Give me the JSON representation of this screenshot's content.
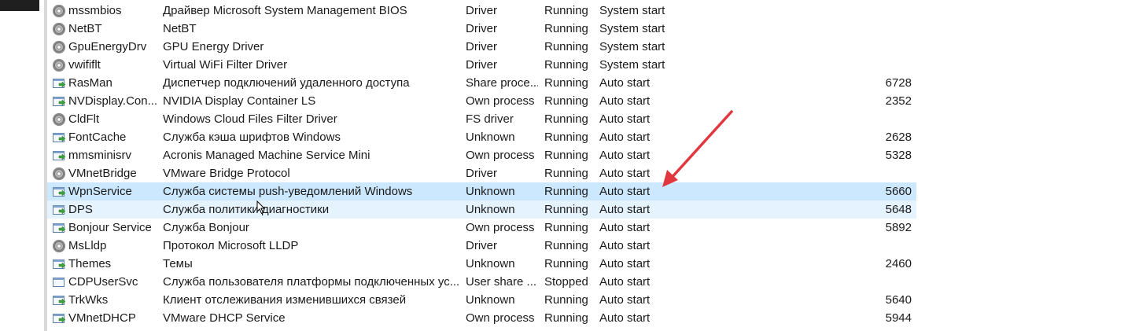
{
  "services": [
    {
      "name": "mssmbios",
      "description": "Драйвер Microsoft System Management BIOS",
      "type": "Driver",
      "status": "Running",
      "start": "System start",
      "pid": "",
      "icon": "gear-icon"
    },
    {
      "name": "NetBT",
      "description": "NetBT",
      "type": "Driver",
      "status": "Running",
      "start": "System start",
      "pid": "",
      "icon": "gear-icon"
    },
    {
      "name": "GpuEnergyDrv",
      "description": "GPU Energy Driver",
      "type": "Driver",
      "status": "Running",
      "start": "System start",
      "pid": "",
      "icon": "gear-icon"
    },
    {
      "name": "vwififlt",
      "description": "Virtual WiFi Filter Driver",
      "type": "Driver",
      "status": "Running",
      "start": "System start",
      "pid": "",
      "icon": "gear-icon"
    },
    {
      "name": "RasMan",
      "description": "Диспетчер подключений удаленного доступа",
      "type": "Share proce...",
      "status": "Running",
      "start": "Auto start",
      "pid": "6728",
      "icon": "service-running-icon"
    },
    {
      "name": "NVDisplay.Con...",
      "description": "NVIDIA Display Container LS",
      "type": "Own process",
      "status": "Running",
      "start": "Auto start",
      "pid": "2352",
      "icon": "service-running-icon"
    },
    {
      "name": "CldFlt",
      "description": "Windows Cloud Files Filter Driver",
      "type": "FS driver",
      "status": "Running",
      "start": "Auto start",
      "pid": "",
      "icon": "gear-icon"
    },
    {
      "name": "FontCache",
      "description": "Служба кэша шрифтов Windows",
      "type": "Unknown",
      "status": "Running",
      "start": "Auto start",
      "pid": "2628",
      "icon": "service-running-icon"
    },
    {
      "name": "mmsminisrv",
      "description": "Acronis Managed Machine Service Mini",
      "type": "Own process",
      "status": "Running",
      "start": "Auto start",
      "pid": "5328",
      "icon": "service-running-icon"
    },
    {
      "name": "VMnetBridge",
      "description": "VMware Bridge Protocol",
      "type": "Driver",
      "status": "Running",
      "start": "Auto start",
      "pid": "",
      "icon": "gear-icon"
    },
    {
      "name": "WpnService",
      "description": "Служба системы push-уведомлений Windows",
      "type": "Unknown",
      "status": "Running",
      "start": "Auto start",
      "pid": "5660",
      "icon": "service-running-icon"
    },
    {
      "name": "DPS",
      "description": "Служба политики диагностики",
      "type": "Unknown",
      "status": "Running",
      "start": "Auto start",
      "pid": "5648",
      "icon": "service-running-icon"
    },
    {
      "name": "Bonjour Service",
      "description": "Служба Bonjour",
      "type": "Own process",
      "status": "Running",
      "start": "Auto start",
      "pid": "5892",
      "icon": "service-running-icon"
    },
    {
      "name": "MsLldp",
      "description": "Протокол Microsoft LLDP",
      "type": "Driver",
      "status": "Running",
      "start": "Auto start",
      "pid": "",
      "icon": "gear-icon"
    },
    {
      "name": "Themes",
      "description": "Темы",
      "type": "Unknown",
      "status": "Running",
      "start": "Auto start",
      "pid": "2460",
      "icon": "service-running-icon"
    },
    {
      "name": "CDPUserSvc",
      "description": "Служба пользователя платформы подключенных ус...",
      "type": "User share ...",
      "status": "Stopped",
      "start": "Auto start",
      "pid": "",
      "icon": "service-stopped-icon"
    },
    {
      "name": "TrkWks",
      "description": "Клиент отслеживания изменившихся связей",
      "type": "Unknown",
      "status": "Running",
      "start": "Auto start",
      "pid": "5640",
      "icon": "service-running-icon"
    },
    {
      "name": "VMnetDHCP",
      "description": "VMware DHCP Service",
      "type": "Own process",
      "status": "Running",
      "start": "Auto start",
      "pid": "5944",
      "icon": "service-running-icon"
    }
  ],
  "selected_rows": [
    "WpnService",
    "DPS"
  ],
  "colors": {
    "selection_strong": "#cce8ff",
    "selection_soft": "#e5f3ff",
    "annotation_arrow": "#e0383e",
    "service_icon_arrow": "#3ea23e",
    "text": "#1a1a1a"
  }
}
